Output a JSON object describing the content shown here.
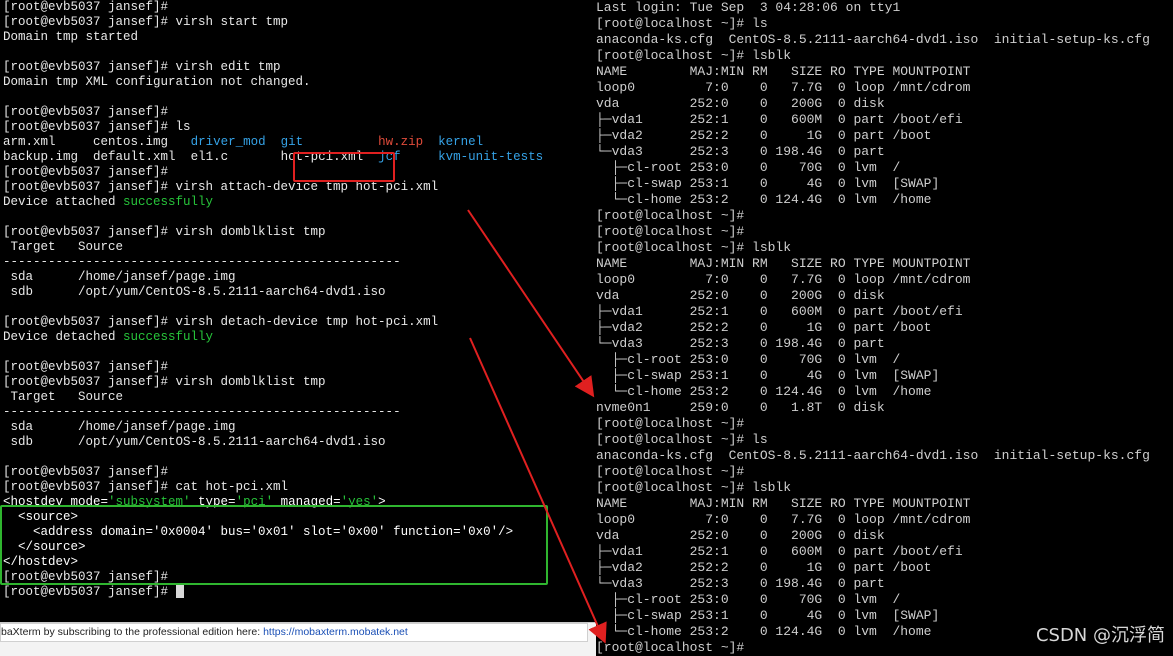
{
  "left_terminal": {
    "lines": [
      "[root@evb5037 jansef]#",
      "[root@evb5037 jansef]# virsh start tmp",
      "Domain tmp started",
      "",
      "[root@evb5037 jansef]# virsh edit tmp",
      "Domain tmp XML configuration not changed.",
      "",
      "[root@evb5037 jansef]#",
      "[root@evb5037 jansef]# ls",
      "LS_ROW_1",
      "LS_ROW_2",
      "[root@evb5037 jansef]#",
      "[root@evb5037 jansef]# virsh attach-device tmp hot-pci.xml",
      "ATTACHED",
      "",
      "[root@evb5037 jansef]# virsh domblklist tmp",
      " Target   Source",
      "-----------------------------------------------------",
      " sda      /home/jansef/page.img",
      " sdb      /opt/yum/CentOS-8.5.2111-aarch64-dvd1.iso",
      "",
      "[root@evb5037 jansef]# virsh detach-device tmp hot-pci.xml",
      "DETACHED",
      "",
      "[root@evb5037 jansef]#",
      "[root@evb5037 jansef]# virsh domblklist tmp",
      " Target   Source",
      "-----------------------------------------------------",
      " sda      /home/jansef/page.img",
      " sdb      /opt/yum/CentOS-8.5.2111-aarch64-dvd1.iso",
      "",
      "[root@evb5037 jansef]#",
      "[root@evb5037 jansef]# cat hot-pci.xml",
      "XML1",
      "XML2",
      "XML3",
      "XML4",
      "XML5",
      "[root@evb5037 jansef]#",
      "PROMPT_CURSOR"
    ],
    "device_attached_prefix": "Device attached ",
    "device_detached_prefix": "Device detached ",
    "success_word": "successfully",
    "ls_row_1": [
      {
        "text": "arm.xml",
        "pad": "     ",
        "color": "white"
      },
      {
        "text": "centos.img",
        "pad": "   ",
        "color": "white"
      },
      {
        "text": "driver_mod",
        "pad": "  ",
        "color": "blue"
      },
      {
        "text": "git",
        "pad": "          ",
        "color": "blue"
      },
      {
        "text": "hw.zip",
        "pad": "  ",
        "color": "red"
      },
      {
        "text": "kernel",
        "pad": "",
        "color": "blue"
      }
    ],
    "ls_row_2": [
      {
        "text": "backup.img",
        "pad": "  ",
        "color": "white"
      },
      {
        "text": "default.xml",
        "pad": "  ",
        "color": "white"
      },
      {
        "text": "el1.c",
        "pad": "       ",
        "color": "white"
      },
      {
        "text": "hot-pci.xml",
        "pad": "  ",
        "color": "white"
      },
      {
        "text": "jcf",
        "pad": "     ",
        "color": "blue"
      },
      {
        "text": "kvm-unit-tests",
        "pad": "",
        "color": "blue"
      }
    ],
    "xml": {
      "l1_open": "<hostdev mode=",
      "l1_mode": "'subsystem'",
      "l1_type_attr": " type=",
      "l1_type": "'pci'",
      "l1_managed_attr": " managed=",
      "l1_managed": "'yes'",
      "l1_close": ">",
      "l2": "  <source>",
      "l3": "    <address domain='0x0004' bus='0x01' slot='0x00' function='0x0'/>",
      "l4": "  </source>",
      "l5": "</hostdev>"
    },
    "final_prompt": "[root@evb5037 jansef]# "
  },
  "footer": {
    "text": "baXterm by subscribing to the professional edition here: ",
    "link": "https://mobaxterm.mobatek.net"
  },
  "right_console": {
    "lines": [
      "Last login: Tue Sep  3 04:28:06 on tty1",
      "[root@localhost ~]# ls",
      "anaconda-ks.cfg  CentOS-8.5.2111-aarch64-dvd1.iso  initial-setup-ks.cfg",
      "[root@localhost ~]# lsblk",
      "NAME        MAJ:MIN RM   SIZE RO TYPE MOUNTPOINT",
      "loop0         7:0    0   7.7G  0 loop /mnt/cdrom",
      "vda         252:0    0   200G  0 disk",
      "├─vda1      252:1    0   600M  0 part /boot/efi",
      "├─vda2      252:2    0     1G  0 part /boot",
      "└─vda3      252:3    0 198.4G  0 part",
      "  ├─cl-root 253:0    0    70G  0 lvm  /",
      "  ├─cl-swap 253:1    0     4G  0 lvm  [SWAP]",
      "  └─cl-home 253:2    0 124.4G  0 lvm  /home",
      "[root@localhost ~]#",
      "[root@localhost ~]#",
      "[root@localhost ~]# lsblk",
      "NAME        MAJ:MIN RM   SIZE RO TYPE MOUNTPOINT",
      "loop0         7:0    0   7.7G  0 loop /mnt/cdrom",
      "vda         252:0    0   200G  0 disk",
      "├─vda1      252:1    0   600M  0 part /boot/efi",
      "├─vda2      252:2    0     1G  0 part /boot",
      "└─vda3      252:3    0 198.4G  0 part",
      "  ├─cl-root 253:0    0    70G  0 lvm  /",
      "  ├─cl-swap 253:1    0     4G  0 lvm  [SWAP]",
      "  └─cl-home 253:2    0 124.4G  0 lvm  /home",
      "nvme0n1     259:0    0   1.8T  0 disk",
      "[root@localhost ~]#",
      "[root@localhost ~]# ls",
      "anaconda-ks.cfg  CentOS-8.5.2111-aarch64-dvd1.iso  initial-setup-ks.cfg",
      "[root@localhost ~]#",
      "[root@localhost ~]# lsblk",
      "NAME        MAJ:MIN RM   SIZE RO TYPE MOUNTPOINT",
      "loop0         7:0    0   7.7G  0 loop /mnt/cdrom",
      "vda         252:0    0   200G  0 disk",
      "├─vda1      252:1    0   600M  0 part /boot/efi",
      "├─vda2      252:2    0     1G  0 part /boot",
      "└─vda3      252:3    0 198.4G  0 part",
      "  ├─cl-root 253:0    0    70G  0 lvm  /",
      "  ├─cl-swap 253:1    0     4G  0 lvm  [SWAP]",
      "  └─cl-home 253:2    0 124.4G  0 lvm  /home",
      "[root@localhost ~]#"
    ]
  },
  "watermark": "CSDN @沉浮简",
  "colors": {
    "success_green": "#27c43a",
    "dir_blue": "#35a2e6",
    "archive_red": "#e04b3a",
    "highlight_box_red": "#e02020",
    "highlight_box_green": "#2fb52f",
    "arrow_red": "#e02020"
  }
}
